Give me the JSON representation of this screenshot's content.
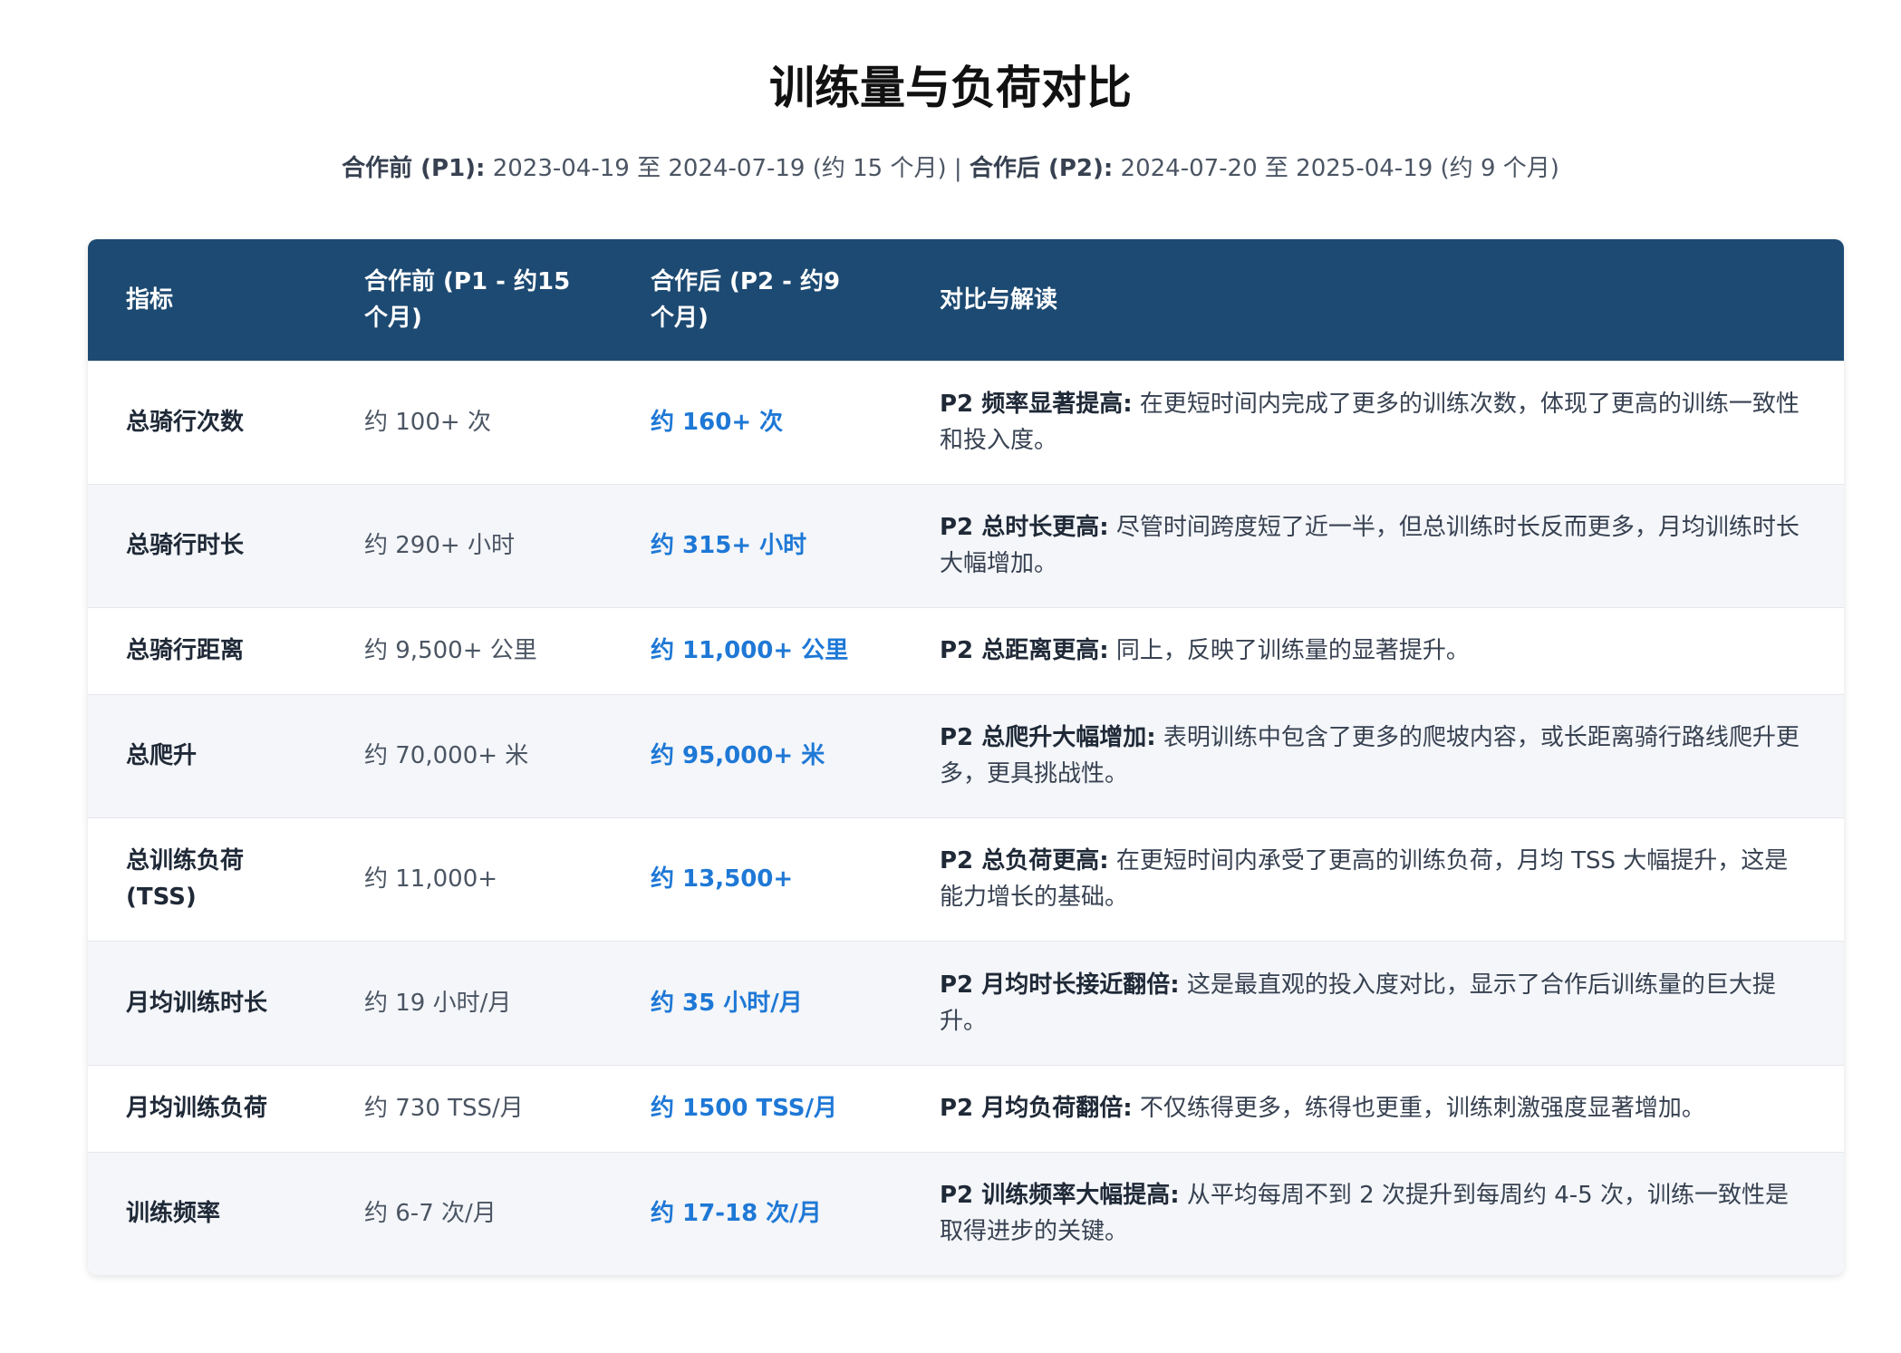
{
  "title": "训练量与负荷对比",
  "subtitle": {
    "p1_label": "合作前 (P1):",
    "p1_range": " 2023-04-19 至 2024-07-19 (约 15 个月) | ",
    "p2_label": "合作后 (P2):",
    "p2_range": " 2024-07-20 至 2025-04-19 (约 9 个月)"
  },
  "table": {
    "headers": [
      "指标",
      "合作前 (P1 - 约15个月)",
      "合作后 (P2 - 约9个月)",
      "对比与解读"
    ],
    "rows": [
      {
        "metric": "总骑行次数",
        "p1": "约 100+ 次",
        "p2": "约 160+ 次",
        "lead": "P2 频率显著提高:",
        "note": " 在更短时间内完成了更多的训练次数，体现了更高的训练一致性和投入度。"
      },
      {
        "metric": "总骑行时长",
        "p1": "约 290+ 小时",
        "p2": "约 315+ 小时",
        "lead": "P2 总时长更高:",
        "note": " 尽管时间跨度短了近一半，但总训练时长反而更多，月均训练时长大幅增加。"
      },
      {
        "metric": "总骑行距离",
        "p1": "约 9,500+ 公里",
        "p2": "约 11,000+ 公里",
        "lead": "P2 总距离更高:",
        "note": " 同上，反映了训练量的显著提升。"
      },
      {
        "metric": "总爬升",
        "p1": "约 70,000+ 米",
        "p2": "约 95,000+ 米",
        "lead": "P2 总爬升大幅增加:",
        "note": " 表明训练中包含了更多的爬坡内容，或长距离骑行路线爬升更多，更具挑战性。"
      },
      {
        "metric": "总训练负荷 (TSS)",
        "p1": "约 11,000+",
        "p2": "约 13,500+",
        "lead": "P2 总负荷更高:",
        "note": " 在更短时间内承受了更高的训练负荷，月均 TSS 大幅提升，这是能力增长的基础。"
      },
      {
        "metric": "月均训练时长",
        "p1": "约 19 小时/月",
        "p2": "约 35 小时/月",
        "lead": "P2 月均时长接近翻倍:",
        "note": " 这是最直观的投入度对比，显示了合作后训练量的巨大提升。"
      },
      {
        "metric": "月均训练负荷",
        "p1": "约 730 TSS/月",
        "p2": "约 1500 TSS/月",
        "lead": "P2 月均负荷翻倍:",
        "note": " 不仅练得更多，练得也更重，训练刺激强度显著增加。"
      },
      {
        "metric": "训练频率",
        "p1": "约 6-7 次/月",
        "p2": "约 17-18 次/月",
        "lead": "P2 训练频率大幅提高:",
        "note": " 从平均每周不到 2 次提升到每周约 4-5 次，训练一致性是取得进步的关键。"
      }
    ]
  }
}
